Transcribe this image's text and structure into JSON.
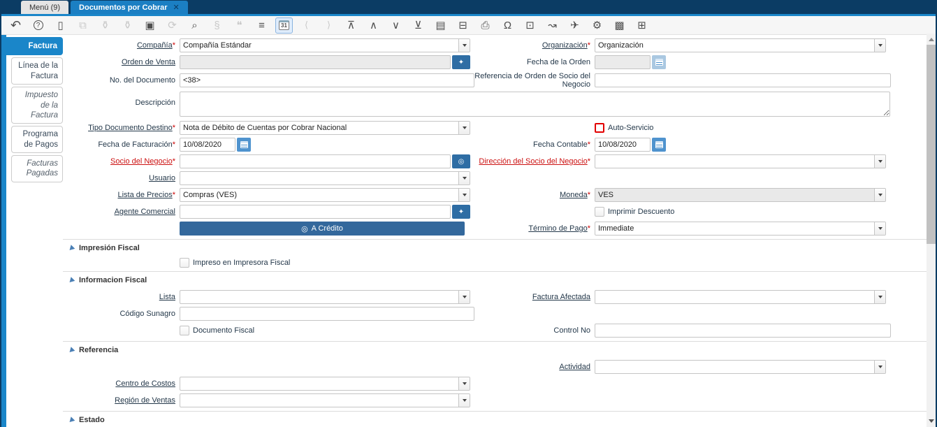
{
  "ui": {
    "required_mark": "*",
    "close_glyph": "✕",
    "zoom_glyph": "✦",
    "record_glyph": "◎",
    "credit_glyph": "◎"
  },
  "colors": {
    "accent_blue": "#1a86c9",
    "tabbar_navy": "#0b3c64",
    "active_tab_blue": "#1b7fc3",
    "field_button_blue": "#2e6da4",
    "credit_button_blue": "#33689c",
    "mandatory_red": "#cc0000",
    "disabled_bg": "#ebebeb"
  },
  "tabbar": {
    "tabs": [
      {
        "id": "menu",
        "label": "Menú (9)",
        "active": false
      },
      {
        "id": "documentos-por-cobrar",
        "label": "Documentos por Cobrar",
        "active": true
      }
    ]
  },
  "toolbar": {
    "items": [
      {
        "name": "undo-icon",
        "glyph": "↶",
        "state": "normal"
      },
      {
        "name": "help-icon",
        "glyph": "?",
        "state": "normal"
      },
      {
        "name": "new-record-icon",
        "glyph": "▯",
        "state": "normal"
      },
      {
        "name": "copy-record-icon",
        "glyph": "⧉",
        "state": "disabled"
      },
      {
        "name": "delete-record-icon",
        "glyph": "⚱",
        "state": "disabled"
      },
      {
        "name": "delete-selection-icon",
        "glyph": "⚱",
        "state": "disabled"
      },
      {
        "name": "save-icon",
        "glyph": "▣",
        "state": "normal"
      },
      {
        "name": "refresh-icon",
        "glyph": "⟳",
        "state": "disabled"
      },
      {
        "name": "find-icon",
        "glyph": "⌕",
        "state": "normal"
      },
      {
        "name": "attachment-icon",
        "glyph": "§",
        "state": "disabled"
      },
      {
        "name": "chat-icon",
        "glyph": "❝",
        "state": "disabled"
      },
      {
        "name": "grid-toggle-icon",
        "glyph": "≡",
        "state": "normal"
      },
      {
        "name": "calendar-icon",
        "glyph": "31",
        "state": "active"
      },
      {
        "name": "previous-record-icon",
        "glyph": "⟨",
        "state": "disabled"
      },
      {
        "name": "next-record-icon",
        "glyph": "⟩",
        "state": "disabled"
      },
      {
        "name": "first-record-icon",
        "glyph": "⊼",
        "state": "normal"
      },
      {
        "name": "up-record-icon",
        "glyph": "∧",
        "state": "normal"
      },
      {
        "name": "down-record-icon",
        "glyph": "∨",
        "state": "normal"
      },
      {
        "name": "last-record-icon",
        "glyph": "⊻",
        "state": "normal"
      },
      {
        "name": "report-icon",
        "glyph": "▤",
        "state": "normal"
      },
      {
        "name": "archive-icon",
        "glyph": "⊟",
        "state": "normal"
      },
      {
        "name": "print-icon",
        "glyph": "⎙",
        "state": "normal"
      },
      {
        "name": "lock-icon",
        "glyph": "Ω",
        "state": "normal"
      },
      {
        "name": "zoom-across-icon",
        "glyph": "⊡",
        "state": "normal"
      },
      {
        "name": "workflow-icon",
        "glyph": "↝",
        "state": "normal"
      },
      {
        "name": "send-icon",
        "glyph": "✈",
        "state": "normal"
      },
      {
        "name": "settings-icon",
        "glyph": "⚙",
        "state": "normal"
      },
      {
        "name": "csv-import-icon",
        "glyph": "▩",
        "state": "normal"
      },
      {
        "name": "quick-form-icon",
        "glyph": "⊞",
        "state": "normal"
      }
    ]
  },
  "sidebar": {
    "tabs": [
      {
        "id": "factura",
        "label": "Factura",
        "active": true,
        "italic": false
      },
      {
        "id": "linea-de-la-factura",
        "label": "Línea de la Factura",
        "active": false,
        "italic": false
      },
      {
        "id": "impuesto-de-la-factura",
        "label": "Impuesto de la Factura",
        "active": false,
        "italic": true
      },
      {
        "id": "programa-de-pagos",
        "label": "Programa de Pagos",
        "active": false,
        "italic": false
      },
      {
        "id": "facturas-pagadas",
        "label": "Facturas Pagadas",
        "active": false,
        "italic": true
      }
    ]
  },
  "form": {
    "compania": {
      "label": "Compañía",
      "required": true,
      "value": "Compañía Estándar"
    },
    "organizacion": {
      "label": "Organización",
      "required": true,
      "value": "Organización"
    },
    "orden_venta": {
      "label": "Orden de Venta",
      "value": ""
    },
    "fecha_orden": {
      "label": "Fecha de la Orden",
      "value": ""
    },
    "no_documento": {
      "label": "No. del Documento",
      "value": "<38>"
    },
    "referencia_orden": {
      "label": "Referencia de Orden de Socio del Negocio",
      "value": ""
    },
    "descripcion": {
      "label": "Descripción",
      "value": ""
    },
    "tipo_documento": {
      "label": "Tipo Documento Destino",
      "required": true,
      "value": "Nota de Débito de Cuentas por Cobrar Nacional"
    },
    "auto_servicio": {
      "label": "Auto-Servicio",
      "checked": false
    },
    "fecha_facturacion": {
      "label": "Fecha de Facturación",
      "required": true,
      "value": "10/08/2020"
    },
    "fecha_contable": {
      "label": "Fecha Contable",
      "required": true,
      "value": "10/08/2020"
    },
    "socio": {
      "label": "Socio del Negocio",
      "required": true,
      "value": ""
    },
    "direccion_socio": {
      "label": "Dirección del Socio del Negocio",
      "required": true,
      "value": ""
    },
    "usuario": {
      "label": "Usuario",
      "value": ""
    },
    "lista_precios": {
      "label": "Lista de Precios",
      "required": true,
      "value": "Compras (VES)"
    },
    "moneda": {
      "label": "Moneda",
      "required": true,
      "value": "VES"
    },
    "agente_comercial": {
      "label": "Agente Comercial",
      "value": ""
    },
    "imprimir_descuento": {
      "label": "Imprimir Descuento",
      "checked": false
    },
    "a_credito": {
      "label": "A Crédito"
    },
    "termino_pago": {
      "label": "Término de Pago",
      "required": true,
      "value": "Immediate"
    }
  },
  "sections": {
    "impresion_fiscal": {
      "title": "Impresión Fiscal",
      "impreso_en_impresora_fiscal": {
        "label": "Impreso en Impresora Fiscal",
        "checked": false
      }
    },
    "informacion_fiscal": {
      "title": "Informacion Fiscal",
      "lista": {
        "label": "Lista",
        "value": ""
      },
      "factura_afectada": {
        "label": "Factura Afectada",
        "value": ""
      },
      "codigo_sunagro": {
        "label": "Código Sunagro",
        "value": ""
      },
      "documento_fiscal": {
        "label": "Documento Fiscal",
        "checked": false
      },
      "control_no": {
        "label": "Control No",
        "value": ""
      }
    },
    "referencia": {
      "title": "Referencia",
      "actividad": {
        "label": "Actividad",
        "value": ""
      },
      "centro_costos": {
        "label": "Centro de Costos",
        "value": ""
      },
      "region_ventas": {
        "label": "Región de Ventas",
        "value": ""
      }
    },
    "estado": {
      "title": "Estado"
    }
  }
}
